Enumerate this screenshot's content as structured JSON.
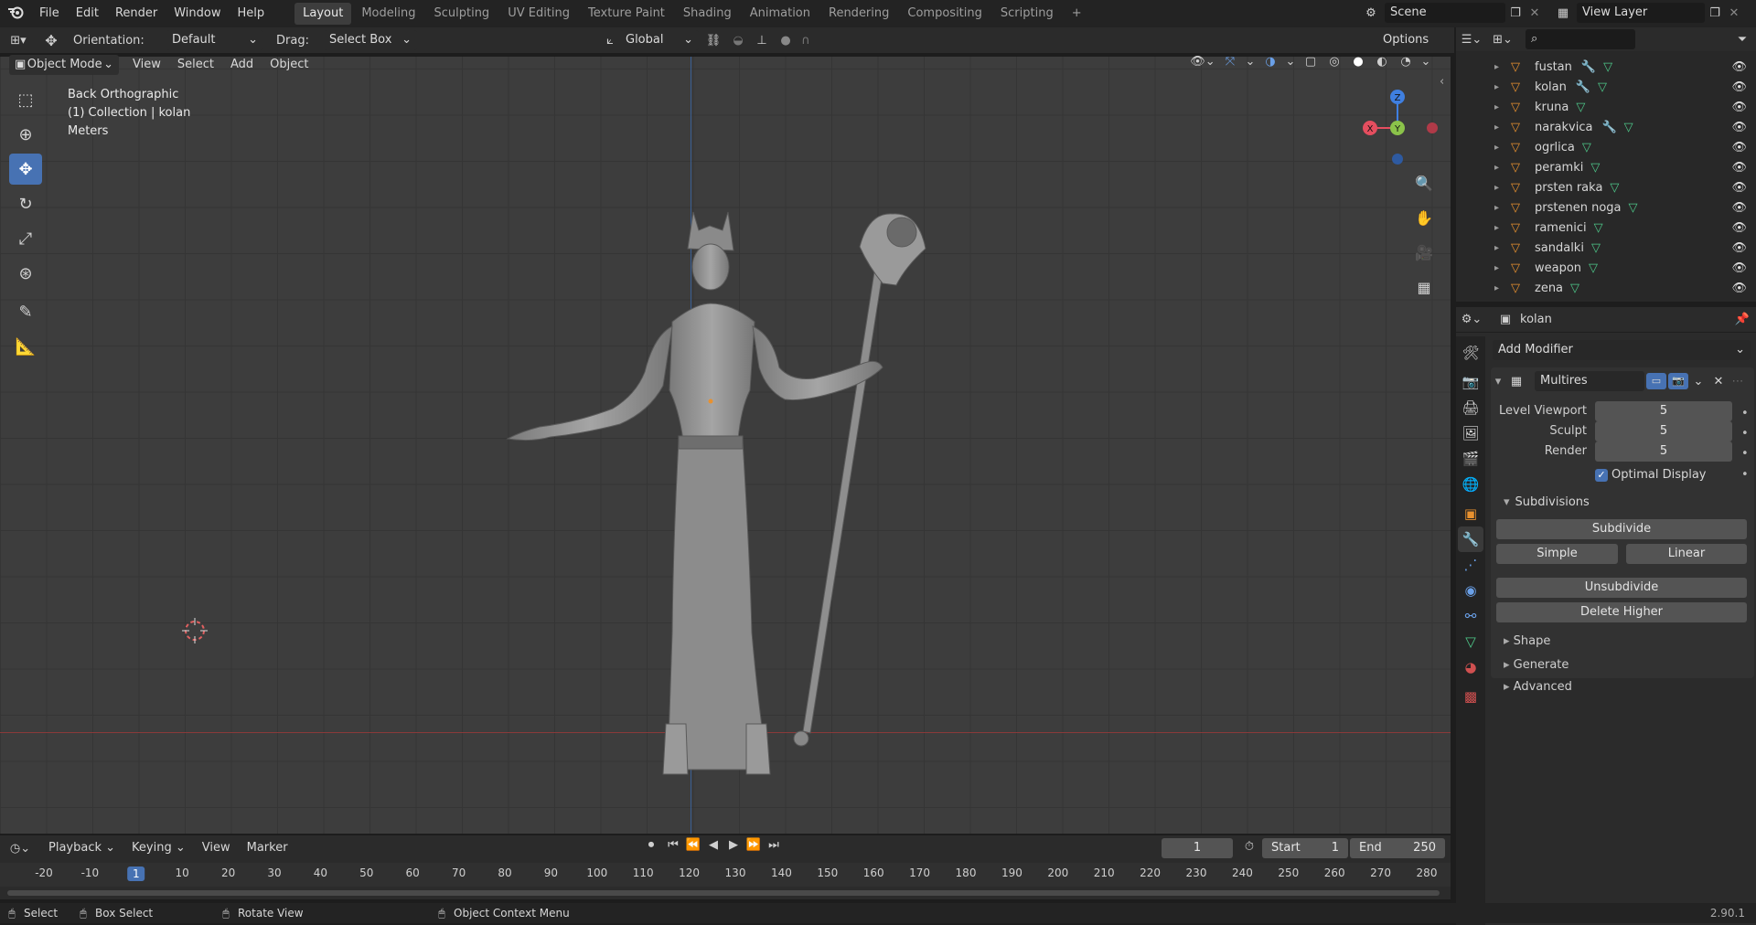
{
  "topbar": {
    "menus": [
      "File",
      "Edit",
      "Render",
      "Window",
      "Help"
    ],
    "workspaces": [
      "Layout",
      "Modeling",
      "Sculpting",
      "UV Editing",
      "Texture Paint",
      "Shading",
      "Animation",
      "Rendering",
      "Compositing",
      "Scripting"
    ],
    "add_tab": "+",
    "scene": "Scene",
    "view_layer": "View Layer"
  },
  "tool_header": {
    "orientation_label": "Orientation:",
    "orientation_value": "Default",
    "drag_label": "Drag:",
    "drag_value": "Select Box",
    "transform_orientation": "Global",
    "options": "Options"
  },
  "viewport_header": {
    "mode": "Object Mode",
    "menus": [
      "View",
      "Select",
      "Add",
      "Object"
    ]
  },
  "viewport_overlay": {
    "view_name": "Back Orthographic",
    "collection": "(1) Collection | kolan",
    "units": "Meters"
  },
  "gizmo": {
    "z": "Z",
    "y": "Y",
    "x": "X"
  },
  "outliner": {
    "items": [
      {
        "name": "fustan",
        "has_modifier": true
      },
      {
        "name": "kolan",
        "has_modifier": true
      },
      {
        "name": "kruna",
        "has_modifier": false
      },
      {
        "name": "narakvica",
        "has_modifier": true
      },
      {
        "name": "ogrlica",
        "has_modifier": false
      },
      {
        "name": "peramki",
        "has_modifier": false
      },
      {
        "name": "prsten raka",
        "has_modifier": false
      },
      {
        "name": "prstenen noga",
        "has_modifier": false
      },
      {
        "name": "ramenici",
        "has_modifier": false
      },
      {
        "name": "sandalki",
        "has_modifier": false
      },
      {
        "name": "weapon",
        "has_modifier": false
      },
      {
        "name": "zena",
        "has_modifier": false
      }
    ]
  },
  "properties": {
    "object_name": "kolan",
    "add_modifier": "Add Modifier",
    "modifier_name": "Multires",
    "fields": [
      {
        "label": "Level Viewport",
        "value": "5"
      },
      {
        "label": "Sculpt",
        "value": "5"
      },
      {
        "label": "Render",
        "value": "5"
      }
    ],
    "optimal_display": "Optimal Display",
    "optimal_display_checked": true,
    "subdivisions_label": "Subdivisions",
    "subdivide": "Subdivide",
    "simple": "Simple",
    "linear": "Linear",
    "unsubdivide": "Unsubdivide",
    "delete_higher": "Delete Higher",
    "subpanels": [
      "Shape",
      "Generate",
      "Advanced"
    ]
  },
  "timeline": {
    "menus": [
      "Playback",
      "Keying",
      "View",
      "Marker"
    ],
    "current_frame": "1",
    "start_label": "Start",
    "start_value": "1",
    "end_label": "End",
    "end_value": "250",
    "ruler": [
      "-20",
      "-10",
      "1",
      "10",
      "20",
      "30",
      "40",
      "50",
      "60",
      "70",
      "80",
      "90",
      "100",
      "110",
      "120",
      "130",
      "140",
      "150",
      "160",
      "170",
      "180",
      "190",
      "200",
      "210",
      "220",
      "230",
      "240",
      "250",
      "260",
      "270",
      "280"
    ]
  },
  "statusbar": {
    "select": "Select",
    "box_select": "Box Select",
    "rotate_view": "Rotate View",
    "context_menu": "Object Context Menu",
    "version": "2.90.1"
  },
  "colors": {
    "accent_blue": "#4772b3",
    "axis_red": "#e54e5f",
    "axis_green": "#8bc34a",
    "axis_blue": "#3f7fe0",
    "object_orange": "#e8912f"
  }
}
